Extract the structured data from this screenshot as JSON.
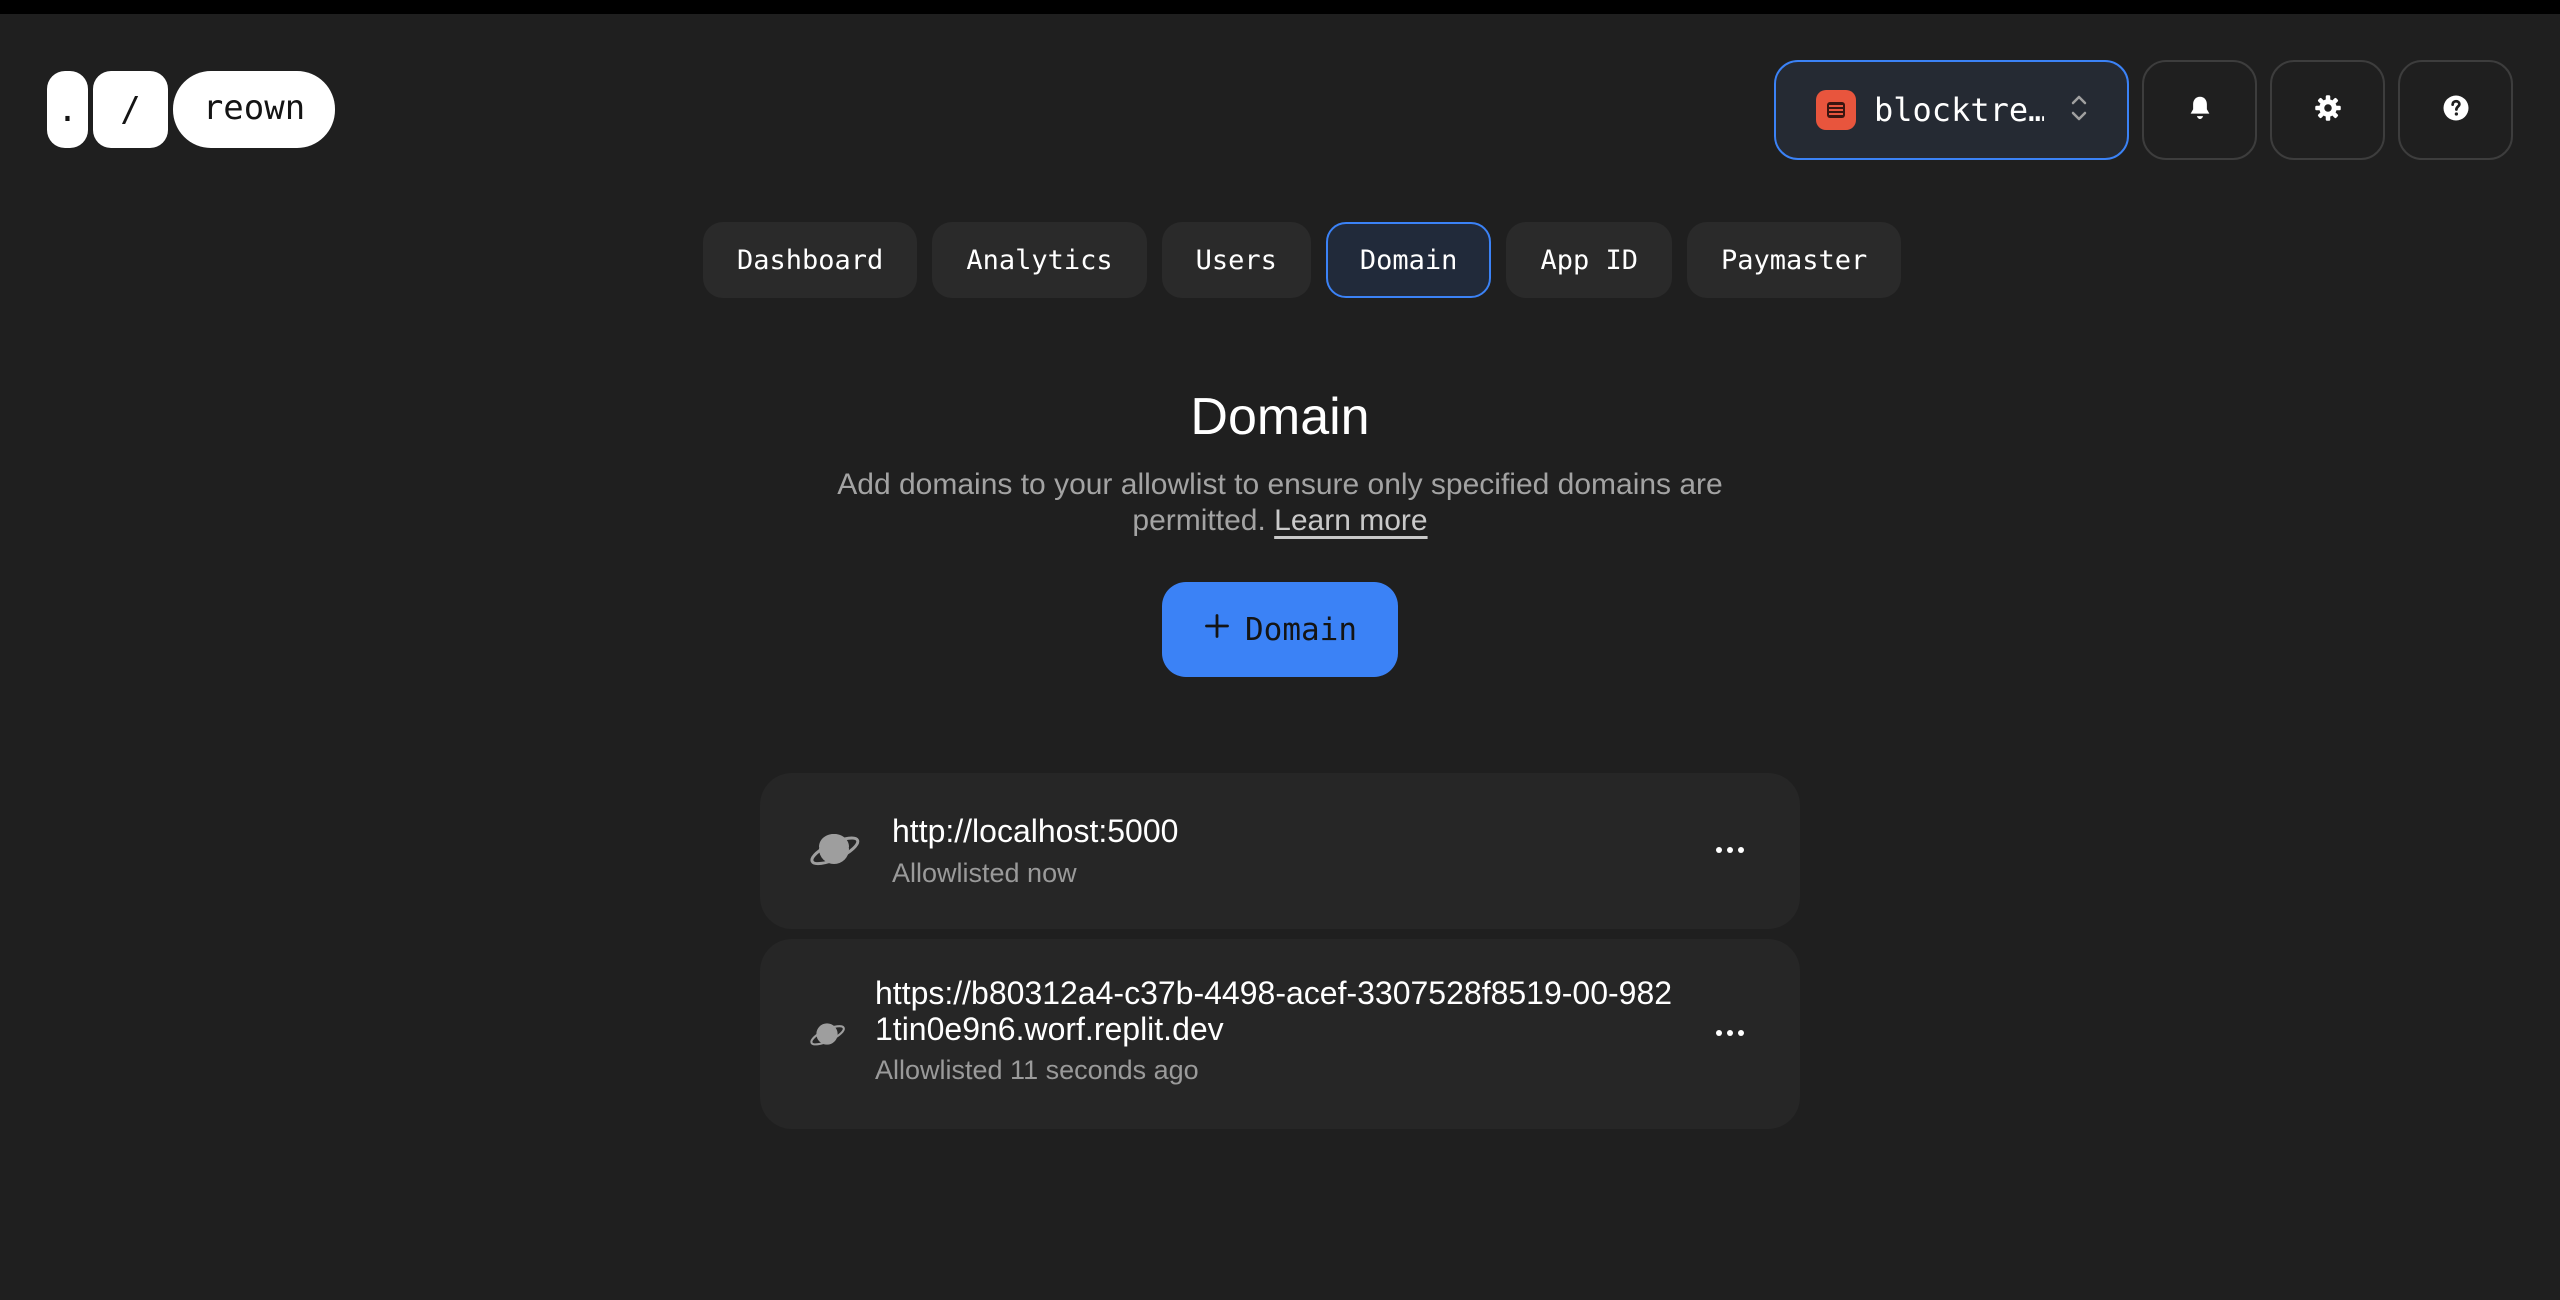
{
  "logo": {
    "dot": ".",
    "slash": "/",
    "name": "reown"
  },
  "project": {
    "name": "blocktre…"
  },
  "tabs": [
    "Dashboard",
    "Analytics",
    "Users",
    "Domain",
    "App ID",
    "Paymaster"
  ],
  "active_tab": "Domain",
  "page": {
    "title": "Domain",
    "description": "Add domains to your allowlist to ensure only specified domains are permitted.",
    "learn_more": "Learn more",
    "add_button": "Domain"
  },
  "domains": [
    {
      "url": "http://localhost:5000",
      "status": "Allowlisted now"
    },
    {
      "url": "https://b80312a4-c37b-4498-acef-3307528f8519-00-9821tin0e9n6.worf.replit.dev",
      "status": "Allowlisted 11 seconds ago"
    }
  ],
  "icons": {
    "project": "stack-icon",
    "switch": "chevron-updown-icon",
    "notifications": "bell-icon",
    "settings": "gear-icon",
    "help": "help-icon",
    "domain": "planet-icon",
    "more": "more-icon",
    "add": "plus-icon"
  },
  "colors": {
    "background": "#1f1f1f",
    "accent": "#3b82f6",
    "project_badge": "#e8553d"
  }
}
